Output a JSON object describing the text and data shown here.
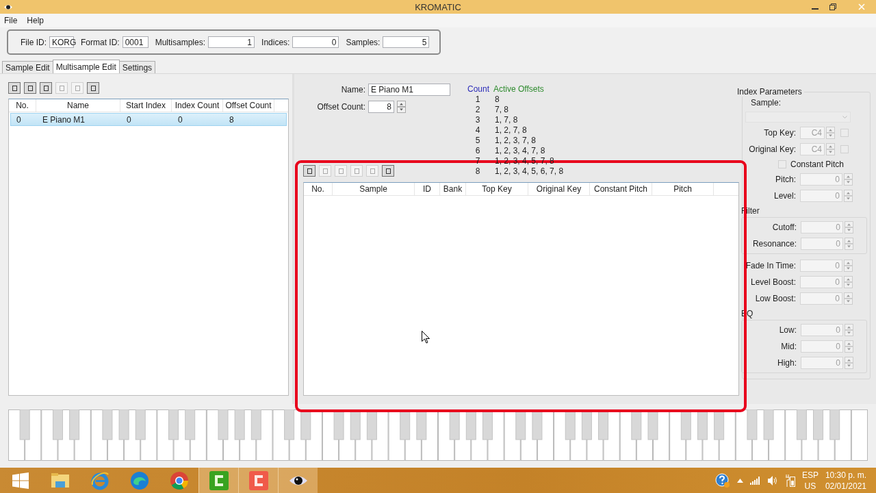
{
  "window": {
    "title": "KROMATIC"
  },
  "menu": [
    "File",
    "Help"
  ],
  "header_fields": [
    {
      "label": "File ID:",
      "value": "KORG",
      "kind": "text"
    },
    {
      "label": "Format ID:",
      "value": "0001",
      "kind": "text"
    },
    {
      "label": "Multisamples:",
      "value": "1",
      "kind": "number"
    },
    {
      "label": "Indices:",
      "value": "0",
      "kind": "number"
    },
    {
      "label": "Samples:",
      "value": "5",
      "kind": "number"
    }
  ],
  "tabs": [
    {
      "label": "Sample Edit",
      "selected": false
    },
    {
      "label": "Multisample Edit",
      "selected": true
    },
    {
      "label": "Settings",
      "selected": false
    }
  ],
  "multisample_toolbar": [
    {
      "enabled": true
    },
    {
      "enabled": true
    },
    {
      "enabled": true
    },
    {
      "enabled": false
    },
    {
      "enabled": false
    },
    {
      "enabled": true
    }
  ],
  "multisample_table": {
    "columns": [
      "No.",
      "Name",
      "Start Index",
      "Index Count",
      "Offset Count"
    ],
    "rows": [
      {
        "cells": [
          "0",
          "E Piano M1",
          "0",
          "0",
          "8"
        ],
        "selected": true
      }
    ]
  },
  "multisample_form": {
    "name": {
      "label": "Name:",
      "value": "E Piano M1"
    },
    "offset_count": {
      "label": "Offset Count:",
      "value": "8"
    }
  },
  "offsets_legend": {
    "headers": [
      "Count",
      "Active Offsets"
    ],
    "rows": [
      {
        "count": "1",
        "offsets": "8"
      },
      {
        "count": "2",
        "offsets": "7, 8"
      },
      {
        "count": "3",
        "offsets": "1, 7, 8"
      },
      {
        "count": "4",
        "offsets": "1, 2, 7, 8"
      },
      {
        "count": "5",
        "offsets": "1, 2, 3, 7, 8"
      },
      {
        "count": "6",
        "offsets": "1, 2, 3, 4, 7, 8"
      },
      {
        "count": "7",
        "offsets": "1, 2, 3, 4, 5, 7, 8"
      },
      {
        "count": "8",
        "offsets": "1, 2, 3, 4, 5, 6, 7, 8"
      }
    ]
  },
  "index_toolbar": [
    {
      "enabled": true
    },
    {
      "enabled": false
    },
    {
      "enabled": false
    },
    {
      "enabled": false
    },
    {
      "enabled": false
    },
    {
      "enabled": true
    }
  ],
  "index_table": {
    "columns": [
      "No.",
      "Sample",
      "ID",
      "Bank",
      "Top Key",
      "Original Key",
      "Constant Pitch",
      "Pitch"
    ]
  },
  "index_parameters": {
    "title": "Index Parameters",
    "disabled": true,
    "sample": {
      "label": "Sample:"
    },
    "key_fields": [
      {
        "label": "Top Key:",
        "value": "C4",
        "checked": false
      },
      {
        "label": "Original Key:",
        "value": "C4",
        "checked": false
      }
    ],
    "constant_pitch": {
      "label": "Constant Pitch",
      "checked": false
    },
    "sections": [
      {
        "kind": "plain",
        "fields": [
          {
            "label": "Pitch:",
            "value": "0"
          },
          {
            "label": "Level:",
            "value": "0"
          }
        ]
      },
      {
        "kind": "group",
        "title": "Filter",
        "fields": [
          {
            "label": "Cutoff:",
            "value": "0"
          },
          {
            "label": "Resonance:",
            "value": "0"
          }
        ]
      },
      {
        "kind": "plain",
        "fields": [
          {
            "label": "Fade In Time:",
            "value": "0"
          },
          {
            "label": "Level Boost:",
            "value": "0"
          },
          {
            "label": "Low Boost:",
            "value": "0"
          }
        ]
      },
      {
        "kind": "group",
        "title": "EQ",
        "fields": [
          {
            "label": "Low:",
            "value": "0"
          },
          {
            "label": "Mid:",
            "value": "0"
          },
          {
            "label": "High:",
            "value": "0"
          }
        ]
      }
    ]
  },
  "taskbar": {
    "apps": [
      {
        "kind": "explorer",
        "active": false
      },
      {
        "kind": "ie",
        "active": false
      },
      {
        "kind": "edge",
        "active": false
      },
      {
        "kind": "chrome",
        "active": false
      },
      {
        "kind": "camtasia-green",
        "active": true
      },
      {
        "kind": "camtasia-red",
        "active": true
      },
      {
        "kind": "eye",
        "active": true
      }
    ],
    "language": [
      "ESP",
      "US"
    ],
    "time": "10:30 p. m.",
    "date": "02/01/2021"
  }
}
